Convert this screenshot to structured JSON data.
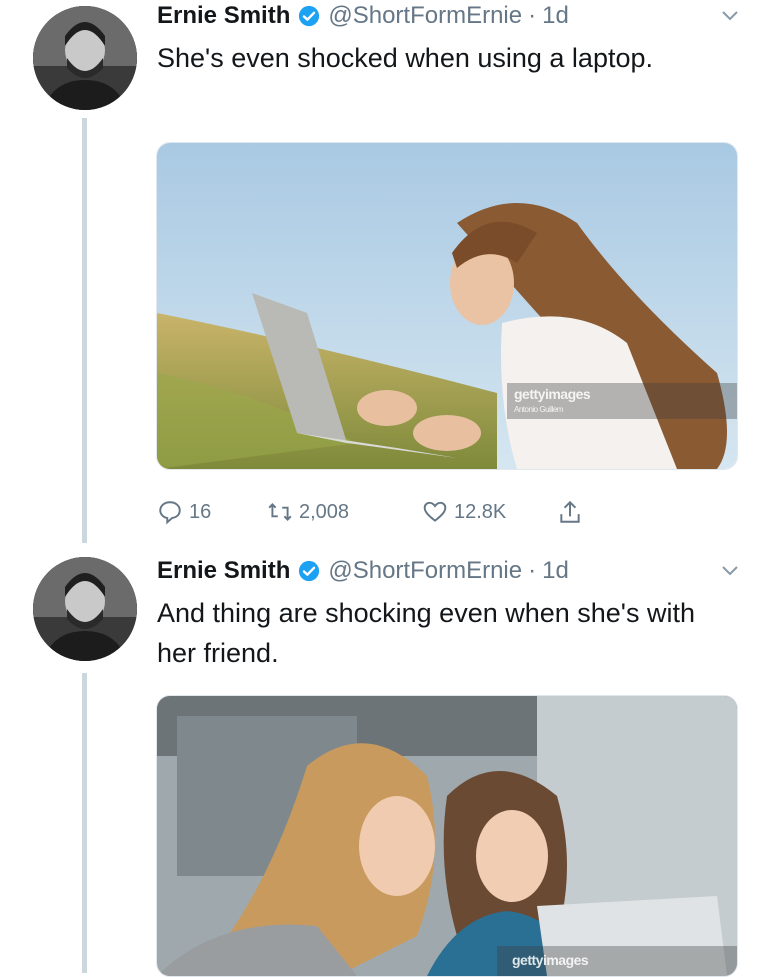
{
  "tweets": [
    {
      "author": {
        "name": "Ernie Smith",
        "handle": "@ShortFormErnie",
        "separator": "·",
        "time": "1d",
        "avatar_icon": "avatar-photo"
      },
      "text": "She's even shocked when using a laptop.",
      "media": {
        "watermark_brand": "gettyimages",
        "watermark_sub": "Antonio Guillem"
      },
      "actions": {
        "replies": "16",
        "retweets": "2,008",
        "likes": "12.8K"
      }
    },
    {
      "author": {
        "name": "Ernie Smith",
        "handle": "@ShortFormErnie",
        "separator": "·",
        "time": "1d",
        "avatar_icon": "avatar-photo"
      },
      "text": "And thing are shocking even when she's with her friend.",
      "media": {
        "watermark_brand": "gettyimages"
      }
    }
  ],
  "colors": {
    "text": "#14171a",
    "secondary": "#657786",
    "verified": "#1da1f2",
    "thread_line": "#ccd6dd"
  }
}
